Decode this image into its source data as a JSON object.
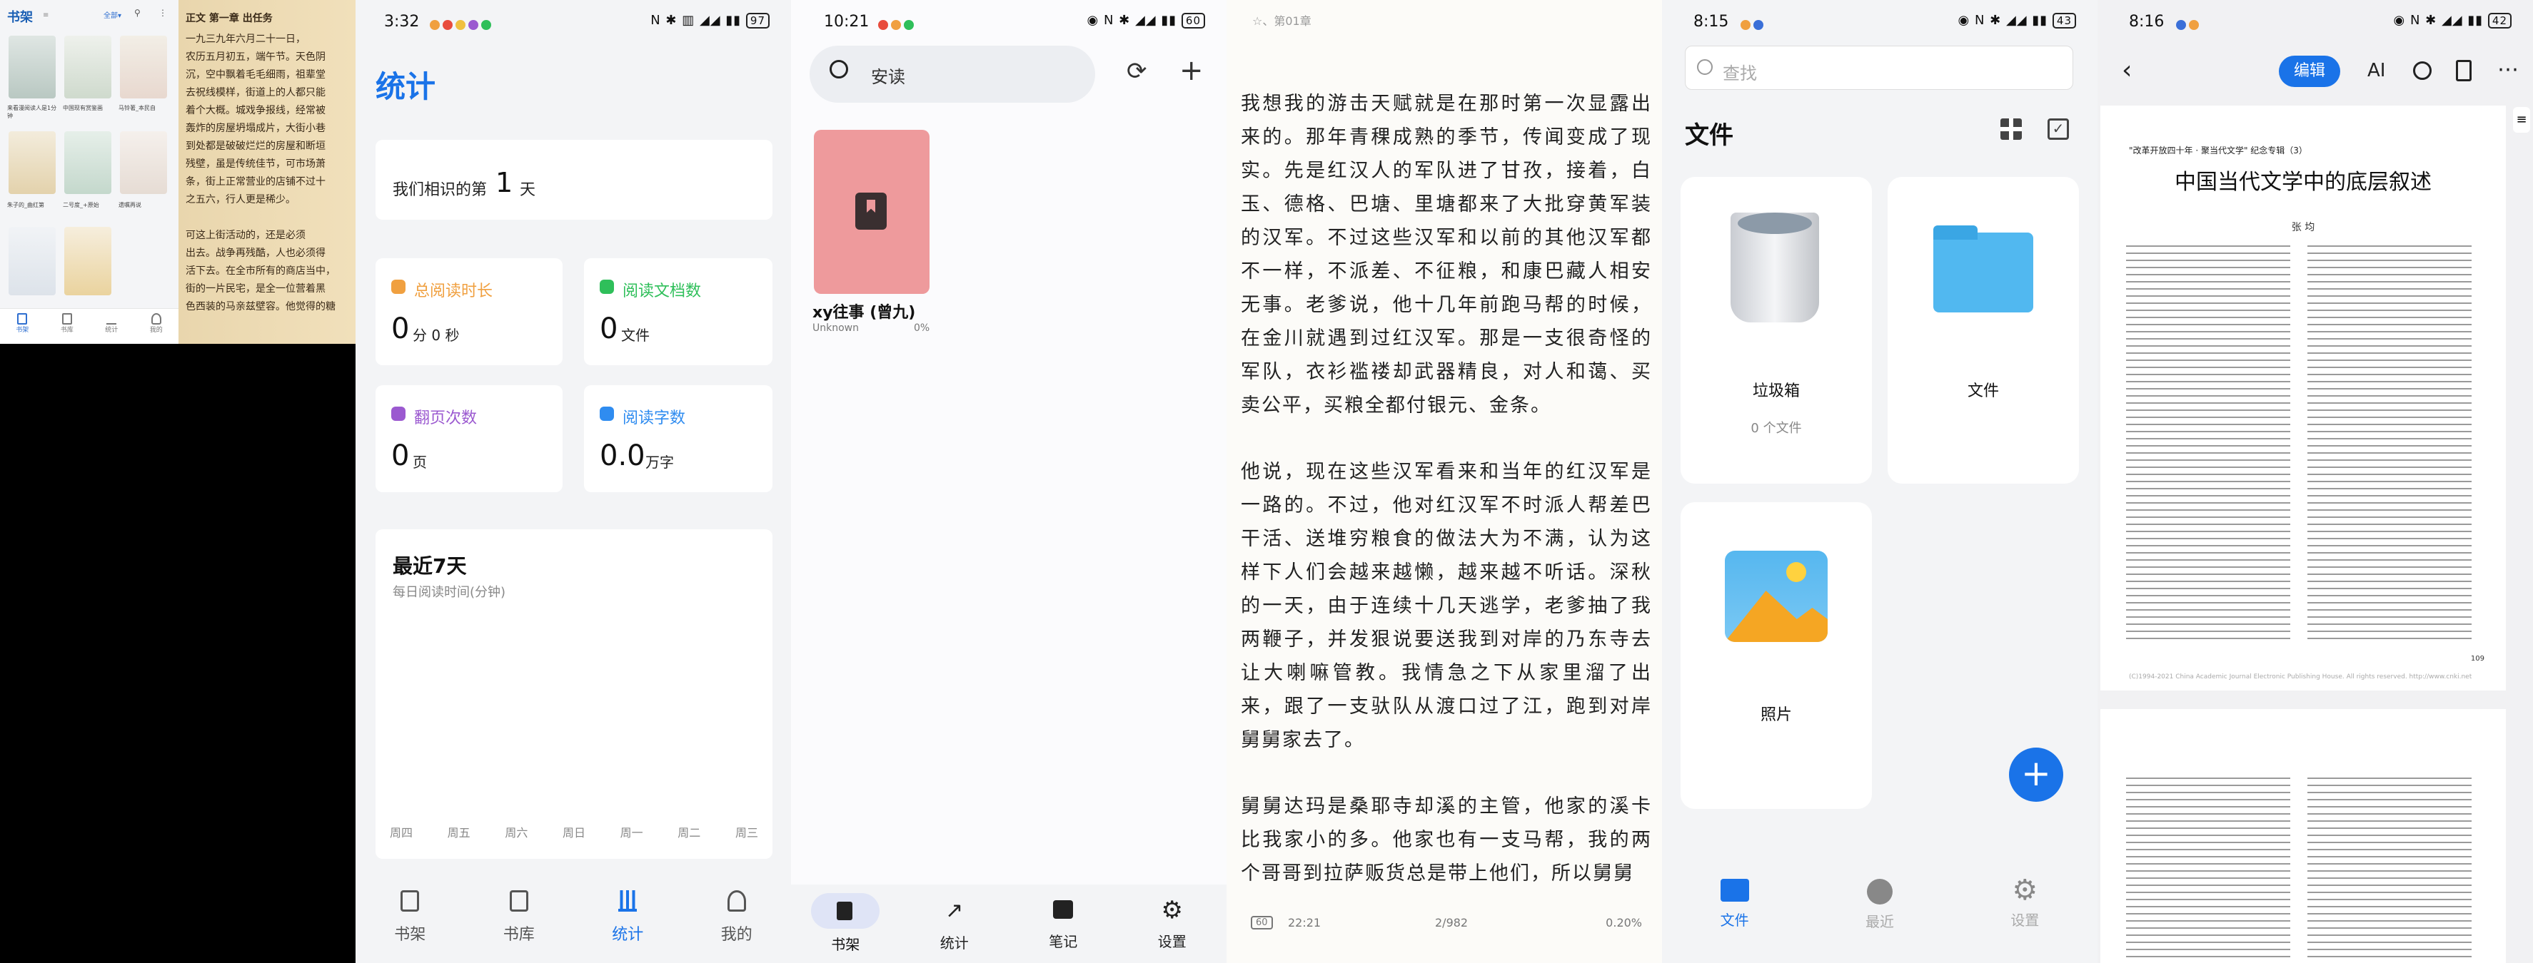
{
  "p1": {
    "title": "书架",
    "filter": "全部",
    "books": [
      "来看漫阅读人是1分钟",
      "中国现有赏鉴画",
      "马铃著_本民自",
      "朱子的_曲红第",
      "二号度_+原始",
      "遗嘱再说"
    ],
    "tabs": [
      "书架",
      "书库",
      "统计",
      "我的"
    ]
  },
  "p1b": {
    "lines": [
      "正文 第一章 出任务",
      "一九三九年六月二十一日，",
      "农历五月初五，端午节。天色阴",
      "沉，空中飘着毛毛细雨，祖辈堂",
      "去祝线模样，街道上的人都只能",
      "着个大概。城戏争报线，经常被",
      "轰炸的房屋坍塌成片，大街小巷",
      "到处都是破破烂烂的房屋和断垣",
      "残壁，虽是传统佳节，可市场萧",
      "条，街上正常营业的店铺不过十",
      "之五六，行人更是稀少。",
      "",
      "可这上街活动的，还是必须",
      "出去。战争再残酷，人也必须得",
      "活下去。在全市所有的商店当中，",
      "街的一片民宅，是全一位营着黑",
      "色西装的马亲兹壁容。他觉得的糖"
    ]
  },
  "p2": {
    "time": "3:32",
    "battery": "97",
    "title": "统计",
    "days_prefix": "我们相识的第",
    "days_value": "1",
    "days_suffix": "天",
    "stats": [
      {
        "label": "总阅读时长",
        "value": "0",
        "unit": "分 0 秒",
        "color": "#f0a040"
      },
      {
        "label": "阅读文档数",
        "value": "0",
        "unit": "文件",
        "color": "#2fbf5a"
      },
      {
        "label": "翻页次数",
        "value": "0",
        "unit": "页",
        "color": "#9b59d0"
      },
      {
        "label": "阅读字数",
        "value": "0.0",
        "unit": "万字",
        "color": "#2f8cf0"
      }
    ],
    "recent_title": "最近7天",
    "recent_sub": "每日阅读时间(分钟)",
    "weekdays": [
      "周四",
      "周五",
      "周六",
      "周日",
      "周一",
      "周二",
      "周三"
    ],
    "tabs": [
      "书架",
      "书库",
      "统计",
      "我的"
    ]
  },
  "p3": {
    "time": "10:21",
    "battery": "60",
    "search": "安读",
    "book_title": "xy往事 (曾九)",
    "book_author": "Unknown",
    "book_progress": "0%",
    "tabs": [
      "书架",
      "统计",
      "笔记",
      "设置"
    ]
  },
  "p4": {
    "header": "☆、第01章",
    "paragraphs": [
      "我想我的游击天赋就是在那时第一次显露出来的。那年青稞成熟的季节，传闻变成了现实。先是红汉人的军队进了甘孜，接着，白玉、德格、巴塘、里塘都来了大批穿黄军装的汉军。不过这些汉军和以前的其他汉军都不一样，不派差、不征粮，和康巴藏人相安无事。老爹说，他十几年前跑马帮的时候，在金川就遇到过红汉军。那是一支很奇怪的军队，衣衫褴褛却武器精良，对人和蔼、买卖公平，买粮全都付银元、金条。",
      "他说，现在这些汉军看来和当年的红汉军是一路的。不过，他对红汉军不时派人帮差巴干活、送堆穷粮食的做法大为不满，认为这样下人们会越来越懒，越来越不听话。深秋的一天，由于连续十几天逃学，老爹抽了我两鞭子，并发狠说要送我到对岸的乃东寺去让大喇嘛管教。我情急之下从家里溜了出来，跟了一支驮队从渡口过了江，跑到对岸舅舅家去了。",
      "舅舅达玛是桑耶寺却溪的主管，他家的溪卡比我家小的多。他家也有一支马帮，我的两个哥哥到拉萨贩货总是带上他们，所以舅舅"
    ],
    "battery": "60",
    "time": "22:21",
    "page": "2/982",
    "percent": "0.20%"
  },
  "p5": {
    "time": "8:15",
    "battery": "43",
    "search": "查找",
    "title": "文件",
    "items": [
      {
        "name": "垃圾箱",
        "sub": "0 个文件"
      },
      {
        "name": "文件",
        "sub": ""
      },
      {
        "name": "照片",
        "sub": ""
      }
    ],
    "tabs": [
      "文件",
      "最近",
      "设置"
    ]
  },
  "p6": {
    "time": "8:16",
    "battery": "42",
    "edit": "编辑",
    "ai": "AI",
    "doc_subtitle": "\"改革开放四十年 · 聚当代文学\" 纪念专辑（3）",
    "doc_title": "中国当代文学中的底层叙述",
    "doc_author": "张  均",
    "page_footer_left": "(C)1994-2021 China Academic Journal Electronic Publishing House. All rights reserved.    http://www.cnki.net",
    "page_number": "109"
  }
}
